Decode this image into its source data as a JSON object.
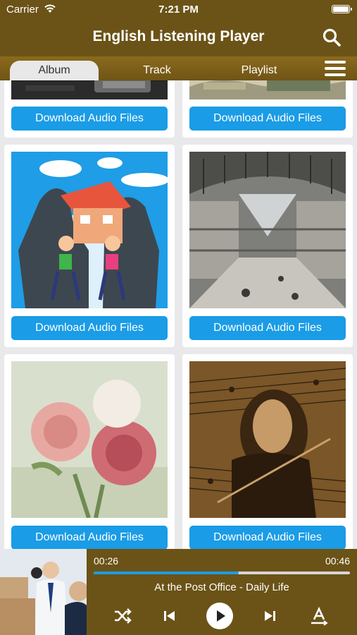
{
  "status_bar": {
    "carrier": "Carrier",
    "time": "7:21 PM"
  },
  "nav": {
    "title": "English Listening Player",
    "search_icon": "search-icon"
  },
  "tabs": [
    {
      "label": "Album",
      "active": true
    },
    {
      "label": "Track",
      "active": false
    },
    {
      "label": "Playlist",
      "active": false
    }
  ],
  "grid": {
    "download_label": "Download Audio Files",
    "albums": [
      {
        "image": "dark-typewriter-photo"
      },
      {
        "image": "money-notes-photo"
      },
      {
        "image": "family-silhouette-cartoon"
      },
      {
        "image": "shopping-mall-atrium-photo"
      },
      {
        "image": "pink-roses-photo"
      },
      {
        "image": "violinist-music-sheet-photo"
      }
    ]
  },
  "player": {
    "elapsed": "00:26",
    "duration": "00:46",
    "progress": 0.5659,
    "track_title": "At the Post Office - Daily Life",
    "artwork": "post-office-workers-photo"
  },
  "colors": {
    "brand": "#6b5317",
    "accent": "#1a9ce6"
  }
}
